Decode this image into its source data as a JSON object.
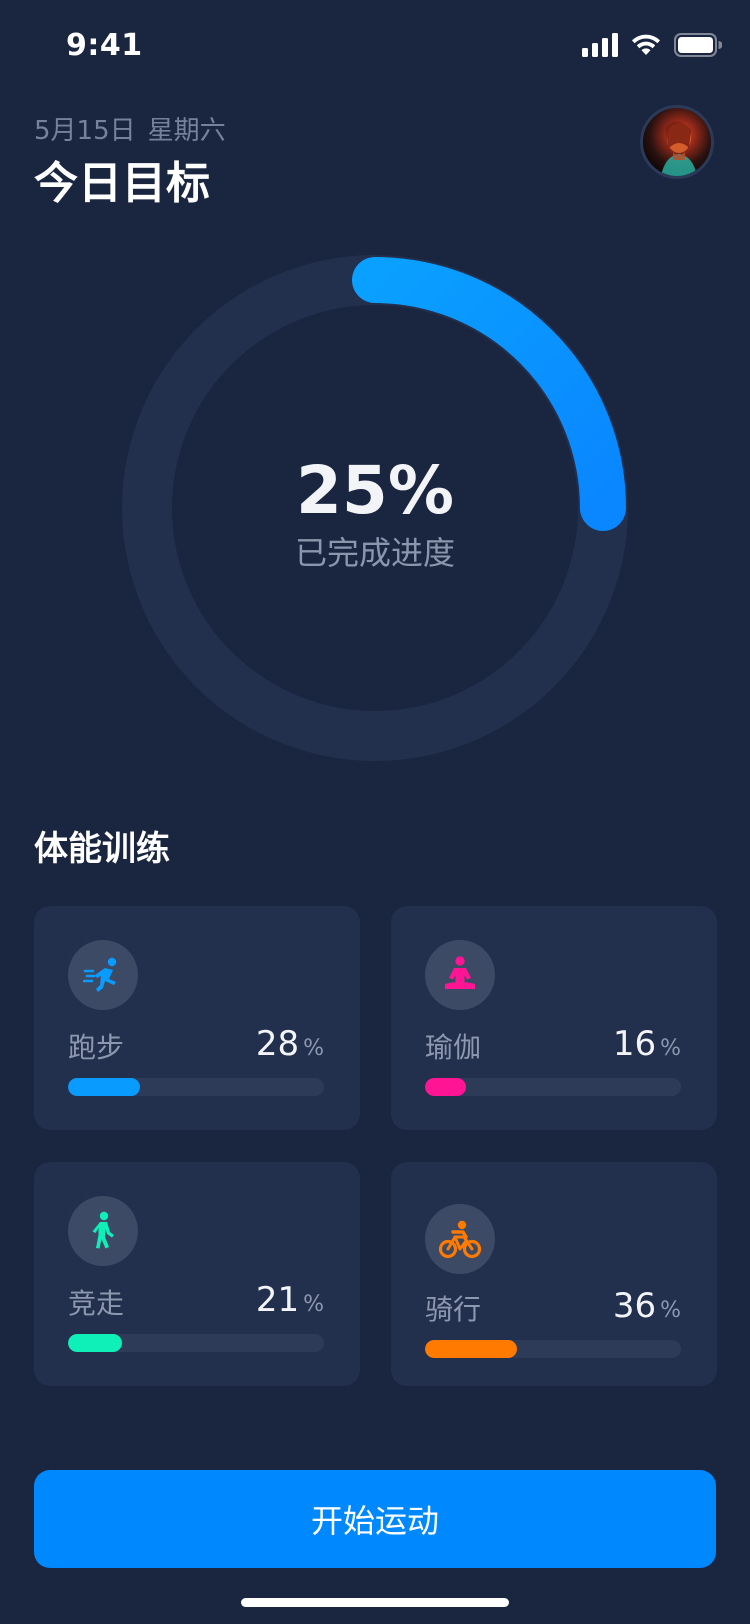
{
  "status_bar": {
    "time": "9:41",
    "icons": [
      "signal-icon",
      "wifi-icon",
      "battery-icon"
    ]
  },
  "header": {
    "date": "5月15日",
    "weekday": "星期六",
    "title": "今日目标"
  },
  "progress": {
    "value_text": "25%",
    "fraction": 0.25,
    "caption": "已完成进度"
  },
  "section": {
    "title": "体能训练"
  },
  "activities": [
    {
      "key": "running",
      "label": "跑步",
      "value": "28",
      "unit": "%",
      "fraction": 0.28,
      "color": "#0a9bff",
      "icon": "running-icon"
    },
    {
      "key": "yoga",
      "label": "瑜伽",
      "value": "16",
      "unit": "%",
      "fraction": 0.16,
      "color": "#ff1493",
      "icon": "yoga-icon"
    },
    {
      "key": "walking",
      "label": "竞走",
      "value": "21",
      "unit": "%",
      "fraction": 0.21,
      "color": "#0ff0b8",
      "icon": "walking-icon"
    },
    {
      "key": "cycling",
      "label": "骑行",
      "value": "36",
      "unit": "%",
      "fraction": 0.36,
      "color": "#ff7a00",
      "icon": "cycling-icon"
    }
  ],
  "cta": {
    "label": "开始运动"
  },
  "colors": {
    "background": "#1a2540",
    "card": "#222f4d",
    "accent": "#0088ff",
    "ring_track": "#222f4d",
    "ring_fill": "#0a96ff"
  }
}
